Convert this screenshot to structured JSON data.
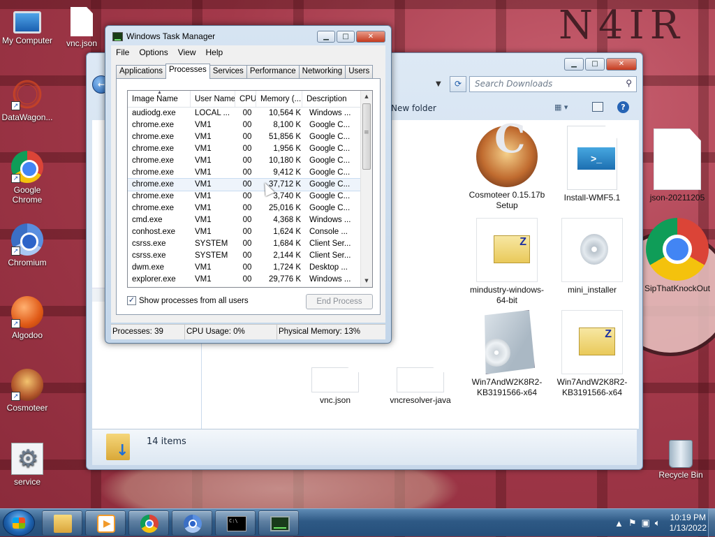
{
  "desktop": {
    "watermark": "N4IR",
    "icons": [
      {
        "label": "My Computer"
      },
      {
        "label": "vnc.json"
      },
      {
        "label": "DataWagon..."
      },
      {
        "label": "Google Chrome"
      },
      {
        "label": "Chromium"
      },
      {
        "label": "Algodoo"
      },
      {
        "label": "Cosmoteer"
      },
      {
        "label": "service"
      },
      {
        "label": "Recycle Bin"
      }
    ]
  },
  "explorer": {
    "search_placeholder": "Search Downloads",
    "new_folder": "New folder",
    "item_count": "14 items",
    "files": [
      {
        "label": "Cosmoteer 0.15.17b Setup"
      },
      {
        "label": "Install-WMF5.1"
      },
      {
        "label": "json-20211205"
      },
      {
        "label": "mindustry-windows-64-bit"
      },
      {
        "label": "mini_installer"
      },
      {
        "label": "SipThatKnockOut"
      },
      {
        "label": "vnc.json"
      },
      {
        "label": "vncresolver-java"
      },
      {
        "label": "Win7AndW2K8R2-KB3191566-x64"
      },
      {
        "label": "Win7AndW2K8R2-KB3191566-x64"
      }
    ]
  },
  "taskmgr": {
    "title": "Windows Task Manager",
    "menu": [
      "File",
      "Options",
      "View",
      "Help"
    ],
    "tabs": [
      "Applications",
      "Processes",
      "Services",
      "Performance",
      "Networking",
      "Users"
    ],
    "active_tab": "Processes",
    "columns": [
      "Image Name",
      "User Name",
      "CPU",
      "Memory (...",
      "Description"
    ],
    "processes": [
      {
        "name": "audiodg.exe",
        "user": "LOCAL ...",
        "cpu": "00",
        "mem": "10,564 K",
        "desc": "Windows ..."
      },
      {
        "name": "chrome.exe",
        "user": "VM1",
        "cpu": "00",
        "mem": "8,100 K",
        "desc": "Google C..."
      },
      {
        "name": "chrome.exe",
        "user": "VM1",
        "cpu": "00",
        "mem": "51,856 K",
        "desc": "Google C..."
      },
      {
        "name": "chrome.exe",
        "user": "VM1",
        "cpu": "00",
        "mem": "1,956 K",
        "desc": "Google C..."
      },
      {
        "name": "chrome.exe",
        "user": "VM1",
        "cpu": "00",
        "mem": "10,180 K",
        "desc": "Google C..."
      },
      {
        "name": "chrome.exe",
        "user": "VM1",
        "cpu": "00",
        "mem": "9,412 K",
        "desc": "Google C..."
      },
      {
        "name": "chrome.exe",
        "user": "VM1",
        "cpu": "00",
        "mem": "37,712 K",
        "desc": "Google C..."
      },
      {
        "name": "chrome.exe",
        "user": "VM1",
        "cpu": "00",
        "mem": "3,740 K",
        "desc": "Google C..."
      },
      {
        "name": "chrome.exe",
        "user": "VM1",
        "cpu": "00",
        "mem": "25,016 K",
        "desc": "Google C..."
      },
      {
        "name": "cmd.exe",
        "user": "VM1",
        "cpu": "00",
        "mem": "4,368 K",
        "desc": "Windows ..."
      },
      {
        "name": "conhost.exe",
        "user": "VM1",
        "cpu": "00",
        "mem": "1,624 K",
        "desc": "Console ..."
      },
      {
        "name": "csrss.exe",
        "user": "SYSTEM",
        "cpu": "00",
        "mem": "1,684 K",
        "desc": "Client Ser..."
      },
      {
        "name": "csrss.exe",
        "user": "SYSTEM",
        "cpu": "00",
        "mem": "2,144 K",
        "desc": "Client Ser..."
      },
      {
        "name": "dwm.exe",
        "user": "VM1",
        "cpu": "00",
        "mem": "1,724 K",
        "desc": "Desktop ..."
      },
      {
        "name": "explorer.exe",
        "user": "VM1",
        "cpu": "00",
        "mem": "29,776 K",
        "desc": "Windows ..."
      }
    ],
    "show_all_label": "Show processes from all users",
    "show_all_checked": true,
    "end_process_label": "End Process",
    "status": {
      "processes": "Processes: 39",
      "cpu": "CPU Usage: 0%",
      "memory": "Physical Memory: 13%"
    }
  },
  "taskbar": {
    "apps": [
      "windows-explorer",
      "media-center",
      "google-chrome",
      "chromium",
      "command-prompt",
      "task-manager"
    ],
    "time": "10:19 PM",
    "date": "1/13/2022"
  }
}
